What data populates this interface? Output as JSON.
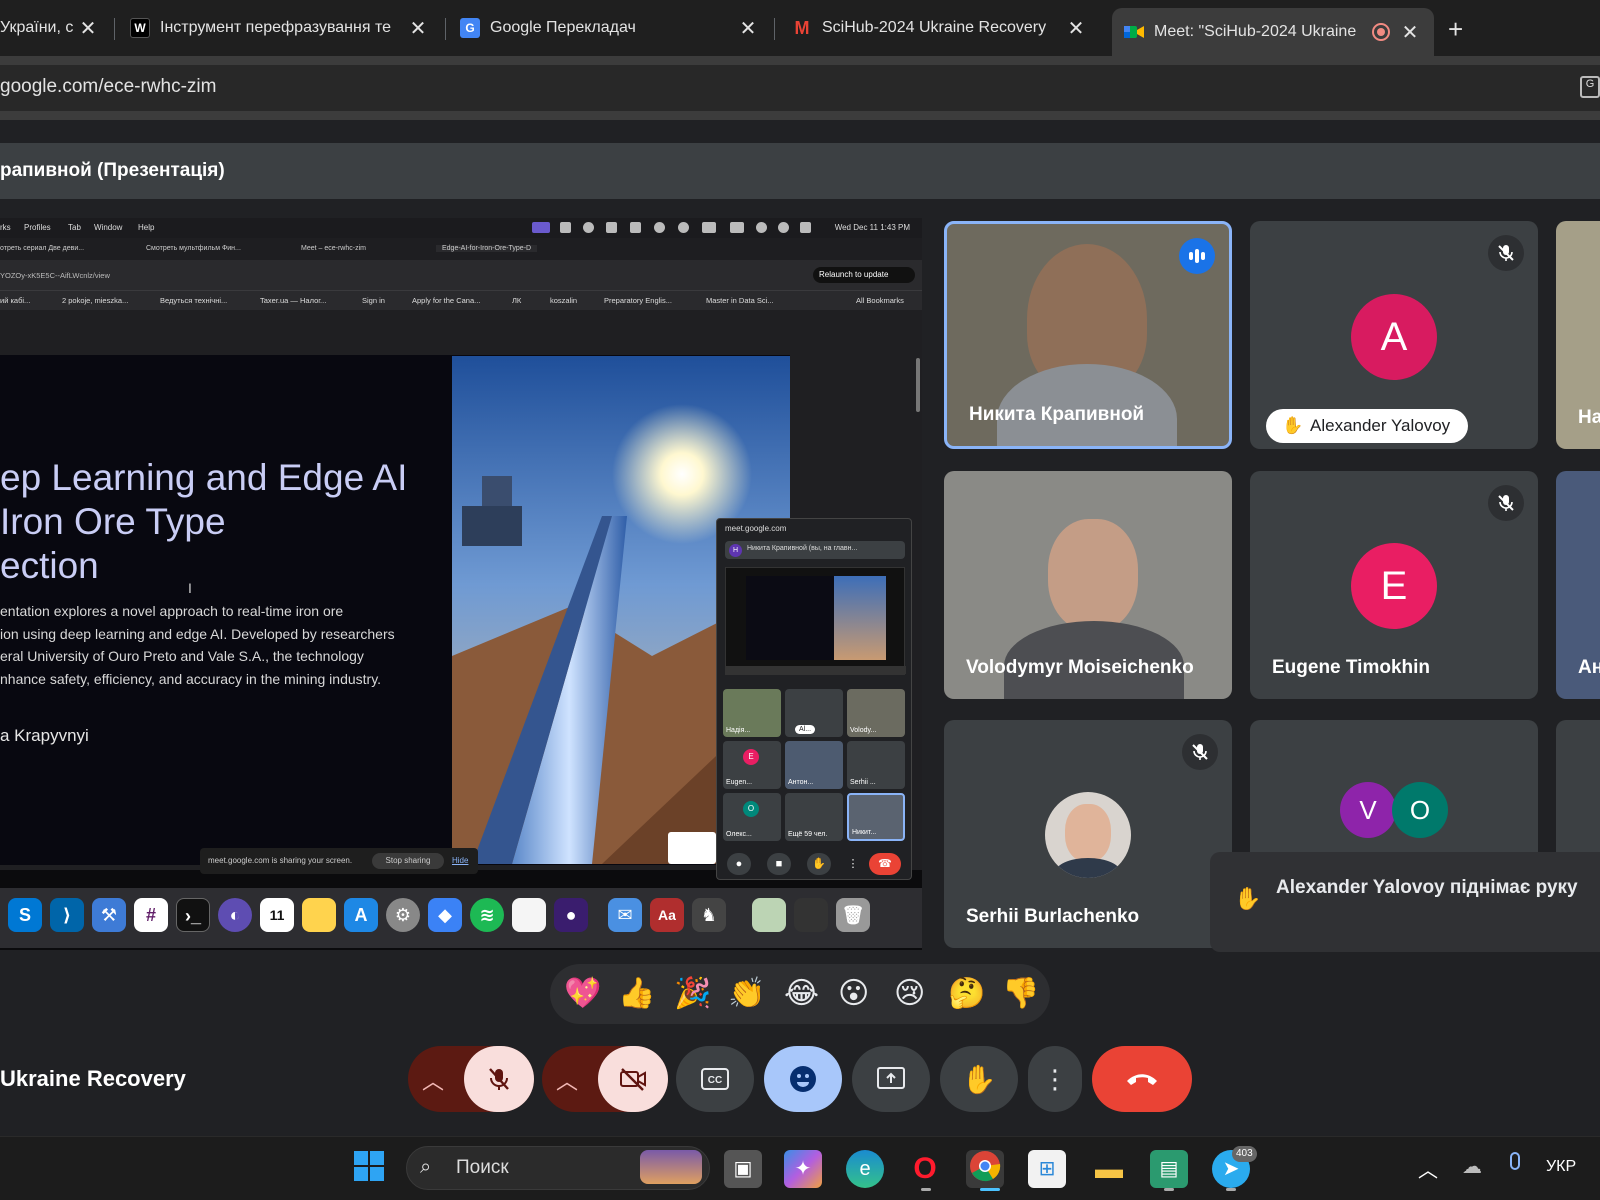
{
  "tabs": [
    {
      "title": "України, с",
      "favicon": "",
      "active": false
    },
    {
      "title": "Інструмент перефразування те",
      "favicon": "W",
      "active": false
    },
    {
      "title": "Google Перекладач",
      "favicon": "G",
      "active": false
    },
    {
      "title": "SciHub-2024 Ukraine Recovery",
      "favicon": "M",
      "active": false
    },
    {
      "title": "Meet: \"SciHub-2024 Ukraine",
      "favicon": "meet",
      "active": true
    }
  ],
  "address": {
    "url": "google.com/ece-rwhc-zim"
  },
  "banner": {
    "text": "рапивной (Презентація)"
  },
  "shared_screen": {
    "menu": [
      "rks",
      "Profiles",
      "Tab",
      "Window",
      "Help"
    ],
    "clock": "Wed Dec 11  1:43 PM",
    "inner_tabs": [
      "отреть сериал Две деви...",
      "Смотреть мультфильм Фин...",
      "Meet – ece-rwhc-zim",
      "Edge-AI-for-Iron-Ore-Type-D"
    ],
    "inner_url": "YOZOy-xK5E5C--AifLWcnlz/view",
    "relaunch": "Relaunch to update",
    "bookmarks": [
      "ий кабі...",
      "2 pokoje, mieszka...",
      "Ведуться технічні...",
      "Taxer.ua — Налог...",
      "Sign in",
      "Apply for the Cana...",
      "ЛК",
      "koszalin",
      "Preparatory Englis...",
      "Master in Data Sci...",
      "All Bookmarks"
    ],
    "slide_title": "ep Learning and Edge AI\nIron Ore Type\nection",
    "slide_body": "entation explores a novel approach to real-time iron ore\nion using deep learning and edge AI. Developed by researchers\neral University of Ouro Preto and Vale S.A., the technology\nnhance safety, efficiency, and accuracy in the mining industry.",
    "slide_author": "a Krapyvnyi",
    "mini_meet": {
      "url": "meet.google.com",
      "bar": "Никита Крапивной (вы, на главн...",
      "avatar": "Н",
      "tiles": [
        "Надія...",
        "Al...",
        "Volody...",
        "Eugen...",
        "Антон...",
        "Serhii ...",
        "Олекс...",
        "Ещё 59 чел.",
        "Никит..."
      ]
    },
    "sharing_text": "meet.google.com is sharing your screen.",
    "stop_sharing": "Stop sharing",
    "hide": "Hide"
  },
  "participants": [
    {
      "name": "Никита Крапивной",
      "type": "video",
      "speaking": true
    },
    {
      "name": "Alexander Yalovoy",
      "type": "avatar",
      "initial": "A",
      "color": "#c2185b",
      "hand_raised": true,
      "muted": true
    },
    {
      "name": "На",
      "type": "video"
    },
    {
      "name": "Volodymyr Moiseichenko",
      "type": "video"
    },
    {
      "name": "Eugene Timokhin",
      "type": "avatar",
      "initial": "E",
      "color": "#e91e63",
      "muted": true
    },
    {
      "name": "Ан",
      "type": "video"
    },
    {
      "name": "Serhii Burlachenko",
      "type": "photo",
      "muted": true
    },
    {
      "name": "",
      "type": "group",
      "initials": [
        "V",
        "O"
      ],
      "colors": [
        "#8e24aa",
        "#00796b"
      ]
    }
  ],
  "notification": {
    "text": "Alexander Yalovoy піднімає руку"
  },
  "reactions": [
    "💖",
    "👍",
    "🎉",
    "👏",
    "😂",
    "😮",
    "😢",
    "🤔",
    "👎"
  ],
  "meeting_name": "Ukraine Recovery",
  "taskbar": {
    "search_placeholder": "Поиск",
    "lang": "УКР",
    "telegram_badge": "403"
  },
  "colors": {
    "accent": "#8ab4f8",
    "end_call": "#ea4335",
    "mic_off_bg": "#f9dedc",
    "reaction_btn": "#a8c7fa"
  }
}
